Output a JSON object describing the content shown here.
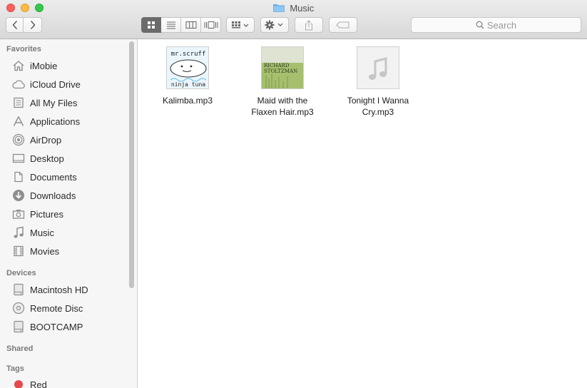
{
  "window": {
    "title": "Music"
  },
  "toolbar": {
    "back_icon": "chevron-left-icon",
    "forward_icon": "chevron-right-icon",
    "view_modes": [
      "icon-view",
      "list-view",
      "column-view",
      "cover-flow-view"
    ],
    "search_placeholder": "Search"
  },
  "sidebar": {
    "favorites_header": "Favorites",
    "favorites": [
      {
        "label": "iMobie",
        "icon": "home-icon"
      },
      {
        "label": "iCloud Drive",
        "icon": "cloud-icon"
      },
      {
        "label": "All My Files",
        "icon": "all-files-icon"
      },
      {
        "label": "Applications",
        "icon": "applications-icon"
      },
      {
        "label": "AirDrop",
        "icon": "airdrop-icon"
      },
      {
        "label": "Desktop",
        "icon": "desktop-icon"
      },
      {
        "label": "Documents",
        "icon": "documents-icon"
      },
      {
        "label": "Downloads",
        "icon": "downloads-icon"
      },
      {
        "label": "Pictures",
        "icon": "camera-icon"
      },
      {
        "label": "Music",
        "icon": "music-note-icon"
      },
      {
        "label": "Movies",
        "icon": "film-icon"
      }
    ],
    "devices_header": "Devices",
    "devices": [
      {
        "label": "Macintosh HD",
        "icon": "hard-drive-icon"
      },
      {
        "label": "Remote Disc",
        "icon": "disc-icon"
      },
      {
        "label": "BOOTCAMP",
        "icon": "hard-drive-icon"
      }
    ],
    "shared_header": "Shared",
    "tags_header": "Tags",
    "tags": [
      {
        "label": "Red",
        "color": "#e5484d"
      }
    ]
  },
  "files": [
    {
      "name": "Kalimba.mp3",
      "art_text_top": "mr.scruff",
      "art_text_bottom": "ninja tuna"
    },
    {
      "name": "Maid with the Flaxen Hair.mp3",
      "art_text_top": "RICHARD",
      "art_text_bottom": "STOLTZMAN"
    },
    {
      "name": "Tonight I Wanna Cry.mp3"
    }
  ],
  "colors": {
    "selected_segment": "#6b6b6b",
    "sidebar_bg": "#f6f6f6"
  }
}
